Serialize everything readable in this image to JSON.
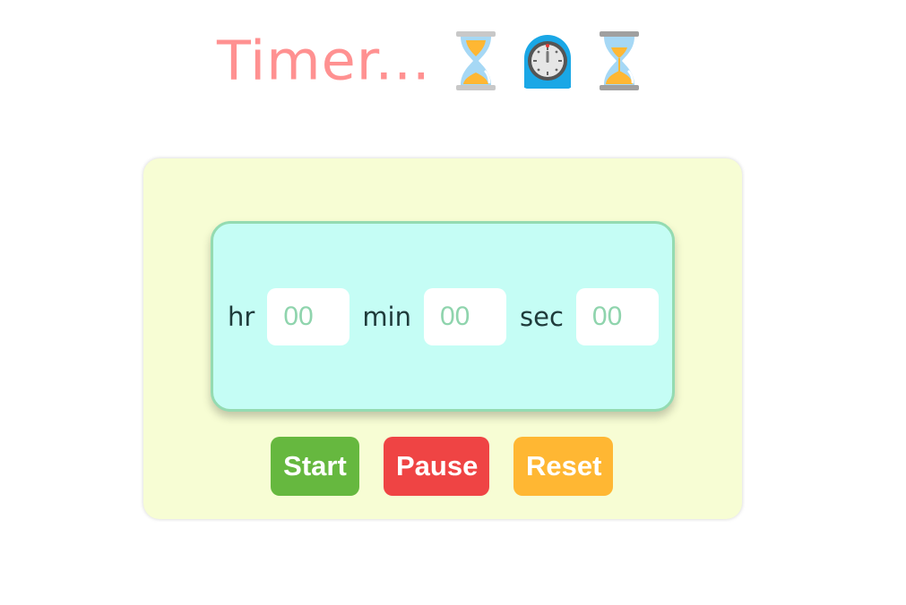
{
  "header": {
    "title": "Timer...",
    "icons": [
      "hourglass-done-icon",
      "timer-clock-icon",
      "hourglass-flowing-icon"
    ]
  },
  "timer": {
    "hours": {
      "label": "hr",
      "placeholder": "00"
    },
    "minutes": {
      "label": "min",
      "placeholder": "00"
    },
    "seconds": {
      "label": "sec",
      "placeholder": "00"
    }
  },
  "controls": {
    "start_label": "Start",
    "pause_label": "Pause",
    "reset_label": "Reset"
  },
  "colors": {
    "title": "#ff9191",
    "card_bg": "#f7fdd4",
    "display_bg": "#c5fdf5",
    "display_border": "#94dbb1",
    "start": "#66b83f",
    "pause": "#ef4444",
    "reset": "#ffb733",
    "placeholder": "#8fd4ad"
  }
}
